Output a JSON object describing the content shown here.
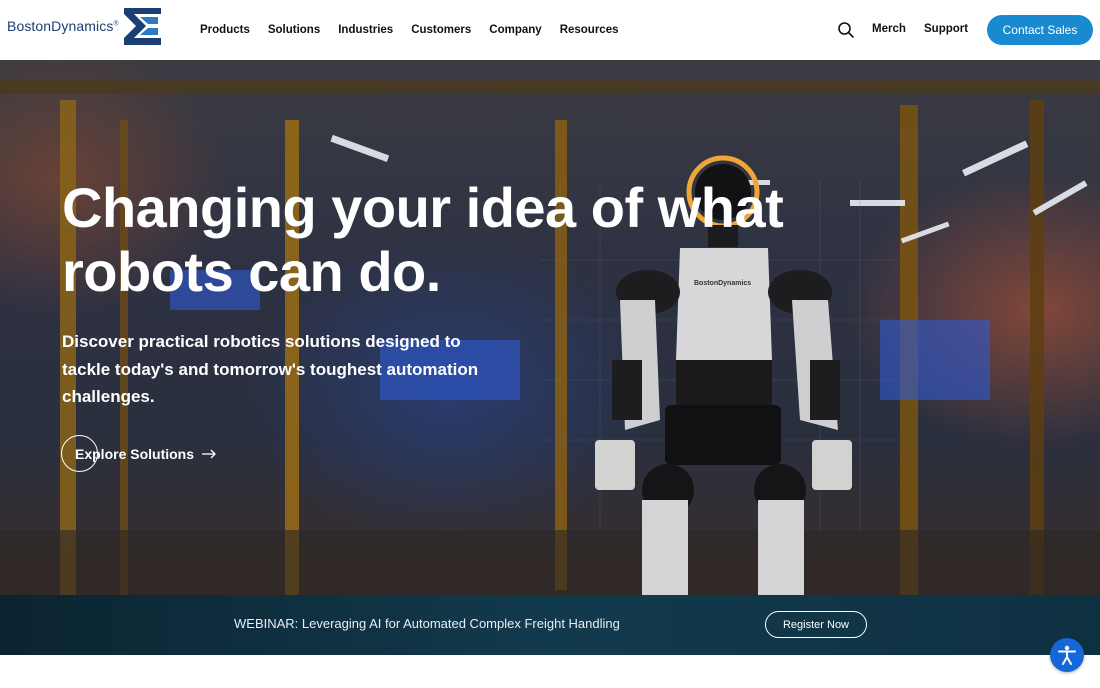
{
  "brand": {
    "name": "BostonDynamics",
    "mark": "®",
    "accent": "#1a8ad0",
    "navy": "#1c3f73"
  },
  "nav": {
    "items": [
      {
        "label": "Products"
      },
      {
        "label": "Solutions"
      },
      {
        "label": "Industries"
      },
      {
        "label": "Customers"
      },
      {
        "label": "Company"
      },
      {
        "label": "Resources"
      }
    ],
    "search_icon": "search-icon",
    "merch": "Merch",
    "support": "Support",
    "contact": "Contact Sales"
  },
  "hero": {
    "title_line1": "Changing your idea of what",
    "title_line2": "robots can do.",
    "subtitle": "Discover practical robotics solutions designed to tackle today's and tomorrow's toughest automation challenges.",
    "cta": "Explore Solutions",
    "cta_icon": "arrow-right-icon",
    "robot_label": "BostonDynamics"
  },
  "banner": {
    "text": "WEBINAR: Leveraging AI for Automated Complex Freight Handling",
    "button": "Register Now"
  },
  "accessibility": {
    "icon": "accessibility-icon",
    "color": "#1566d6"
  }
}
